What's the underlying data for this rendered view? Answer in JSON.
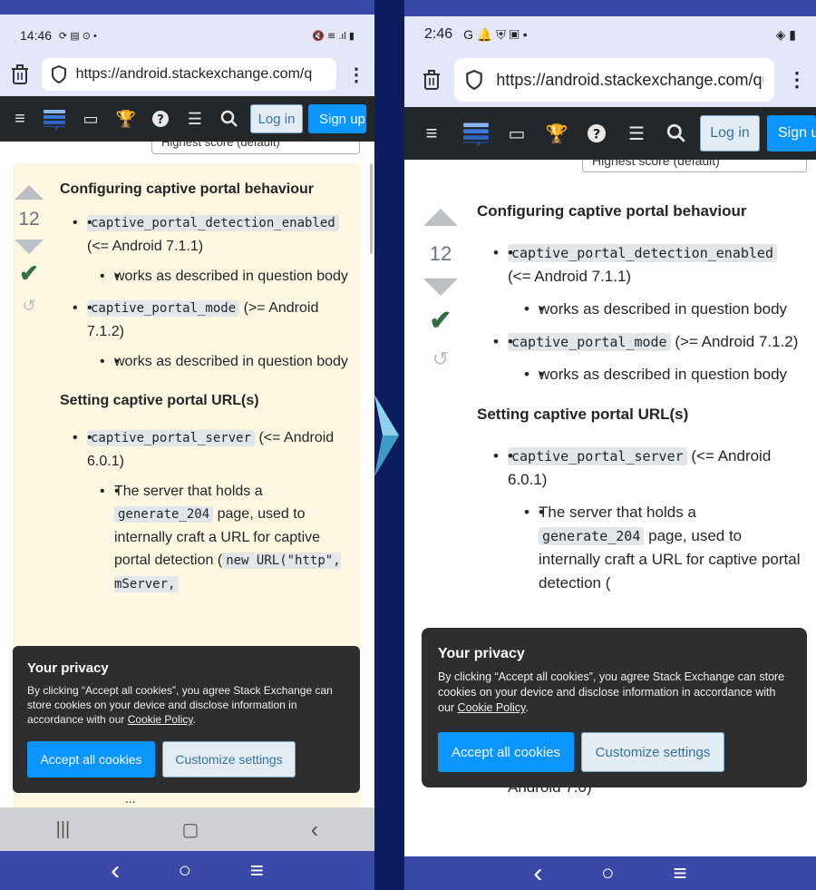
{
  "left": {
    "status": {
      "time": "14:46",
      "icons": "⟳ ▤ ⊙ •",
      "right_icons": "🔇 ≋ .ıl ▮"
    },
    "url": "https://android.stackexchange.com/q",
    "login": "Log in",
    "signup": "Sign up",
    "sort_label": "Highest score (default)",
    "score": "12",
    "cookie_title": "Your privacy",
    "cookie_body_pre": "By clicking “Accept all cookies”, you agree Stack Exchange can store cookies on your device and disclose information in accordance with our ",
    "cookie_link": "Cookie Policy",
    "cookie_body_post": ".",
    "accept": "Accept all cookies",
    "customize": "Customize settings",
    "below_cookie": "..."
  },
  "right": {
    "status": {
      "time": "2:46",
      "icons": "G 🔔 ⛨ ▣ •",
      "right_icons": "◈ ▮"
    },
    "url": "https://android.stackexchange.com/qu",
    "login": "Log in",
    "signup": "Sign u",
    "sort_label": "Highest score (default)",
    "score": "12",
    "cookie_title": "Your privacy",
    "cookie_body_pre": "By clicking “Accept all cookies”, you agree Stack Exchange can store cookies on your device and disclose information in accordance with our ",
    "cookie_link": "Cookie Policy",
    "cookie_body_post": ".",
    "accept": "Accept all cookies",
    "customize": "Customize settings",
    "below_cookie": "Android 7.0)"
  },
  "answer": {
    "h1": "Configuring captive portal behaviour",
    "item1_code": "captive_portal_detection_enabled",
    "item1_text": "(<= Android 7.1.1)",
    "item1_sub": "works as described in question body",
    "item2_code": "captive_portal_mode",
    "item2_text": "(>= Android 7.1.2)",
    "item2_sub": "works as described in question body",
    "h2": "Setting captive portal URL(s)",
    "item3_code": "captive_portal_server",
    "item3_text": "(<= Android 6.0.1)",
    "item3_sub_pre": "The server that holds a",
    "item3_sub_code": "generate_204",
    "item3_sub_mid": "page, used to internally craft a URL for captive portal detection (",
    "item3_sub_code2": "new URL(\"http\", mServer,"
  },
  "icons": {
    "trash": "trash-icon",
    "shield": "shield-icon",
    "menu": "hamburger-icon",
    "logo": "stack-exchange-logo",
    "inbox": "inbox-icon",
    "trophy": "trophy-icon",
    "help": "help-icon",
    "sites": "site-switcher-icon",
    "search": "search-icon"
  },
  "nav": {
    "recents": "|||",
    "home": "▢",
    "back": "‹",
    "back2": "‹",
    "home2": "○",
    "menu2": "≡"
  }
}
